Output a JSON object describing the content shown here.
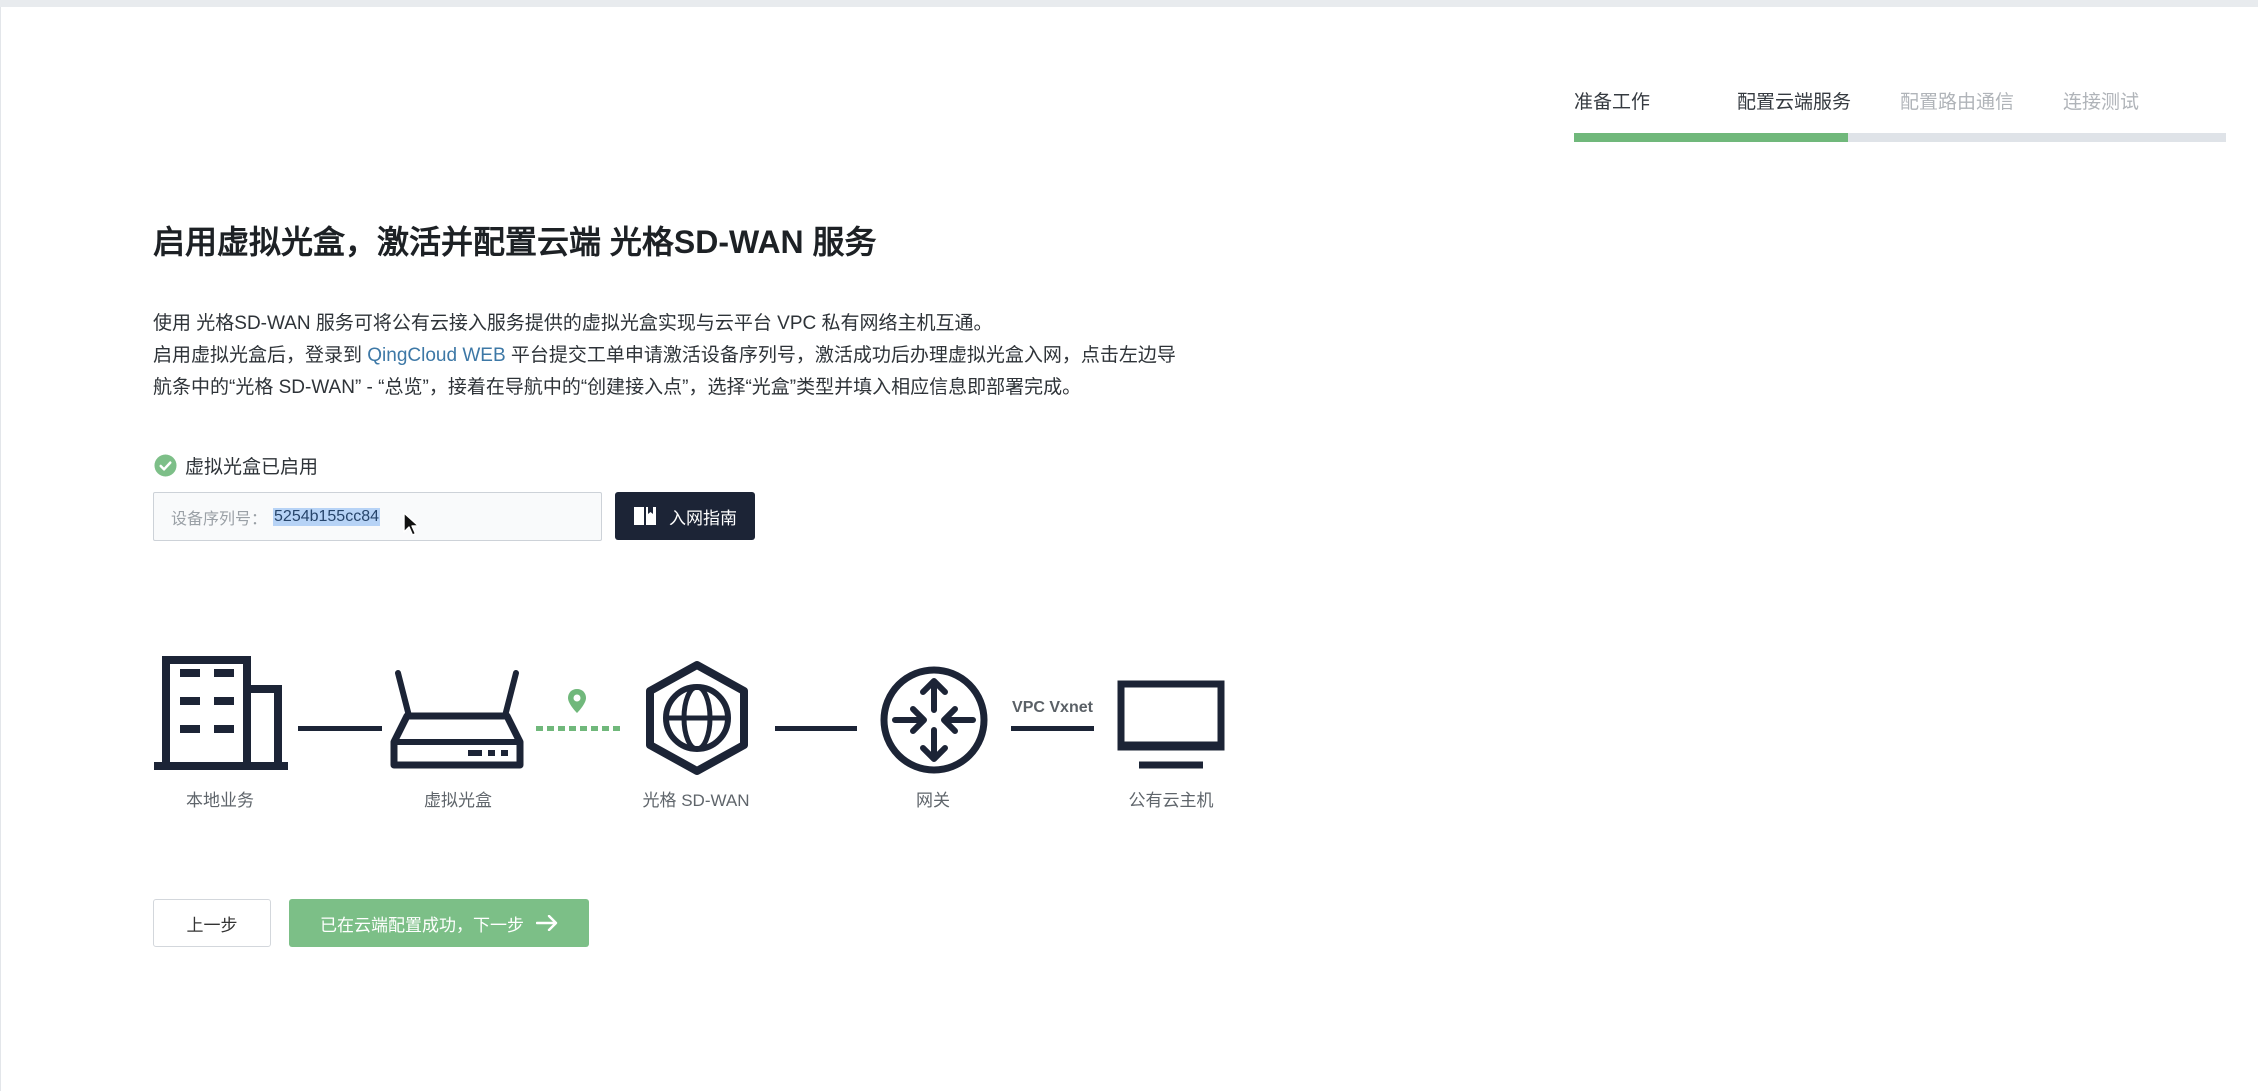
{
  "steps": {
    "items": [
      {
        "label": "准备工作",
        "active": true
      },
      {
        "label": "配置云端服务",
        "active": true
      },
      {
        "label": "配置路由通信",
        "active": false
      },
      {
        "label": "连接测试",
        "active": false
      }
    ],
    "progress_fraction": 0.42
  },
  "title": "启用虚拟光盒，激活并配置云端 光格SD-WAN 服务",
  "description": {
    "line1": "使用 光格SD-WAN 服务可将公有云接入服务提供的虚拟光盒实现与云平台 VPC 私有网络主机互通。",
    "line2_before": "启用虚拟光盒后，登录到 ",
    "link": "QingCloud WEB",
    "line2_after": " 平台提交工单申请激活设备序列号，激活成功后办理虚拟光盒入网，点击左边导",
    "line3": "航条中的“光格 SD-WAN” - “总览”，接着在导航中的“创建接入点”，选择“光盒”类型并填入相应信息即部署完成。"
  },
  "status": {
    "text": "虚拟光盒已启用",
    "icon": "check-circle-icon"
  },
  "serial": {
    "label": "设备序列号：",
    "value": "5254b155cc84"
  },
  "guide_button": {
    "label": "入网指南",
    "icon": "book-icon"
  },
  "topology": {
    "nodes": [
      {
        "label": "本地业务",
        "icon": "building-icon"
      },
      {
        "label": "虚拟光盒",
        "icon": "router-icon"
      },
      {
        "label": "光格 SD-WAN",
        "icon": "globe-hexagon-icon"
      },
      {
        "label": "网关",
        "icon": "gateway-icon"
      },
      {
        "label": "公有云主机",
        "icon": "monitor-icon"
      }
    ],
    "vxnet_label": "VPC Vxnet",
    "pin_icon": "location-pin-icon"
  },
  "actions": {
    "prev_label": "上一步",
    "next_label": "已在云端配置成功，下一步",
    "next_icon": "arrow-right-icon"
  },
  "colors": {
    "accent_green": "#70b87b",
    "button_green": "#7cbf87",
    "check_green": "#7dbf88",
    "dark": "#1c2436",
    "link": "#3d78a6",
    "progress_track": "#dfe3e8",
    "selection": "#b7d3f6"
  }
}
